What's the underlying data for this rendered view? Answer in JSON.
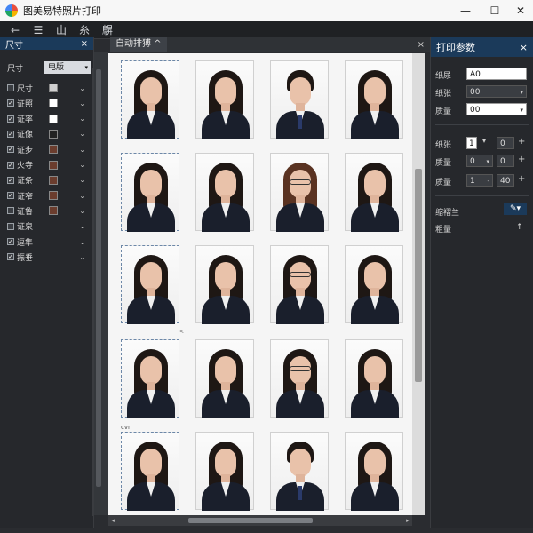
{
  "app": {
    "title": "图美易特照片打印"
  },
  "window": {
    "minimize": "—",
    "maximize": "☐",
    "close": "✕"
  },
  "toolbar": {
    "items": [
      {
        "name": "back-icon",
        "glyph": "←"
      },
      {
        "name": "list-icon",
        "glyph": "☰"
      },
      {
        "name": "mountain-icon",
        "glyph": "山"
      },
      {
        "name": "grid-layout-icon",
        "glyph": "糸"
      },
      {
        "name": "qr-icon",
        "glyph": "鵿"
      }
    ]
  },
  "left_panel": {
    "title": "尺寸",
    "close": "×",
    "top_label": "尺寸",
    "top_value": "电版",
    "rows": [
      {
        "checked": false,
        "label": "尺寸",
        "swatch": "#d0d0d0"
      },
      {
        "checked": true,
        "label": "证照",
        "swatch": "#ffffff"
      },
      {
        "checked": true,
        "label": "证率",
        "swatch": "#ffffff"
      },
      {
        "checked": true,
        "label": "证像",
        "swatch": "#222222"
      },
      {
        "checked": true,
        "label": "证步",
        "swatch": "#6b3d2e"
      },
      {
        "checked": true,
        "label": "火寺",
        "swatch": "#6b3d2e"
      },
      {
        "checked": true,
        "label": "证条",
        "swatch": "#6b3d2e"
      },
      {
        "checked": true,
        "label": "证窄",
        "swatch": "#6b3d2e"
      },
      {
        "checked": false,
        "label": "证鲁",
        "swatch": "#6b3d2e"
      },
      {
        "checked": false,
        "label": "证泉",
        "swatch": ""
      },
      {
        "checked": true,
        "label": "逗隼",
        "swatch": ""
      },
      {
        "checked": true,
        "label": "振垂",
        "swatch": ""
      }
    ]
  },
  "center": {
    "tab_label": "自动排猼 ^",
    "close": "×",
    "caption": "cvn",
    "mark": "<",
    "photos": [
      {
        "type": "female",
        "dashed": true
      },
      {
        "type": "female",
        "dashed": false
      },
      {
        "type": "male",
        "dashed": false
      },
      {
        "type": "female",
        "dashed": false
      },
      {
        "type": "female",
        "dashed": true
      },
      {
        "type": "female",
        "dashed": false
      },
      {
        "type": "female-glasses-red",
        "dashed": false
      },
      {
        "type": "female",
        "dashed": false
      },
      {
        "type": "female",
        "dashed": true
      },
      {
        "type": "female",
        "dashed": false
      },
      {
        "type": "female-glasses",
        "dashed": false
      },
      {
        "type": "female",
        "dashed": false
      },
      {
        "type": "female",
        "dashed": true
      },
      {
        "type": "female",
        "dashed": false
      },
      {
        "type": "female-glasses",
        "dashed": false
      },
      {
        "type": "female",
        "dashed": false
      },
      {
        "type": "female",
        "dashed": true
      },
      {
        "type": "female",
        "dashed": false
      },
      {
        "type": "male",
        "dashed": false
      },
      {
        "type": "female",
        "dashed": false
      }
    ]
  },
  "right_panel": {
    "title": "打印参数",
    "close": "×",
    "fields": [
      {
        "label": "纸尿",
        "value": "A0"
      },
      {
        "label": "纸张",
        "value": "00"
      },
      {
        "label": "质量",
        "value": "00"
      }
    ],
    "spin_rows": [
      {
        "label": "纸张",
        "a": "1",
        "b": "0"
      },
      {
        "label": "质量",
        "a": "0",
        "b": "0"
      },
      {
        "label": "质量",
        "a": "1",
        "b": "40"
      }
    ],
    "shrink_label": "缩褶兰",
    "shrink_icon": "pen-icon",
    "thickness_label": "粗量",
    "thickness_value": "↑"
  },
  "colors": {
    "accent": "#1b3a5a",
    "panel": "#26282c"
  }
}
